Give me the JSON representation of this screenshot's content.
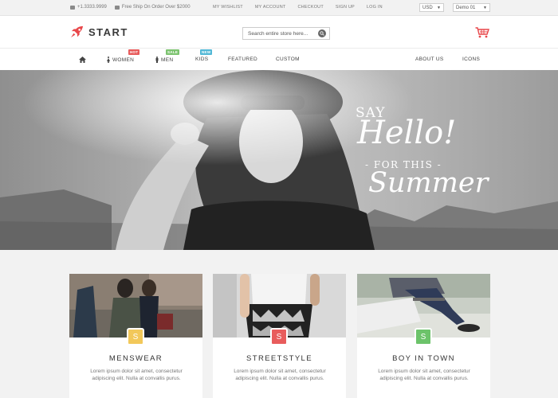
{
  "topbar": {
    "phone": "+1.3333.9999",
    "shipping": "Free Ship On Order Over $2000",
    "links": [
      "MY WISHLIST",
      "MY ACCOUNT",
      "CHECKOUT",
      "SIGN UP",
      "LOG IN"
    ],
    "currency": "USD",
    "demo": "Demo 01"
  },
  "header": {
    "logo_text": "START",
    "search_placeholder": "Search entire store here...",
    "icons": {
      "logo": "rocket-icon",
      "search": "search-icon",
      "cart": "cart-icon"
    }
  },
  "nav": {
    "items": [
      {
        "label": "",
        "icon": "home-icon"
      },
      {
        "label": "WOMEN",
        "icon": "female-icon",
        "badge": "HOT"
      },
      {
        "label": "MEN",
        "icon": "male-icon",
        "badge": "SALE"
      },
      {
        "label": "KIDS",
        "badge": "NEW"
      },
      {
        "label": "FEATURED"
      },
      {
        "label": "CUSTOM"
      },
      {
        "label": "ABOUT US"
      },
      {
        "label": "ICONS"
      }
    ]
  },
  "hero": {
    "line1": "SAY",
    "line2": "Hello!",
    "line3": "- FOR THIS -",
    "line4": "Summer"
  },
  "cards": [
    {
      "tag": "S",
      "title": "MENSWEAR",
      "desc": "Lorem ipsum dolor sit amet, consectetur adipiscing elit. Nulla at convallis purus.",
      "color": "#f2c85a"
    },
    {
      "tag": "S",
      "title": "STREETSTYLE",
      "desc": "Lorem ipsum dolor sit amet, consectetur adipiscing elit. Nulla at convallis purus.",
      "color": "#e85c5c"
    },
    {
      "tag": "S",
      "title": "BOY IN TOWN",
      "desc": "Lorem ipsum dolor sit amet, consectetur adipiscing elit. Nulla at convallis purus.",
      "color": "#6cc36a"
    }
  ],
  "colors": {
    "accent": "#e8474a",
    "background": "#f2f2f2"
  }
}
